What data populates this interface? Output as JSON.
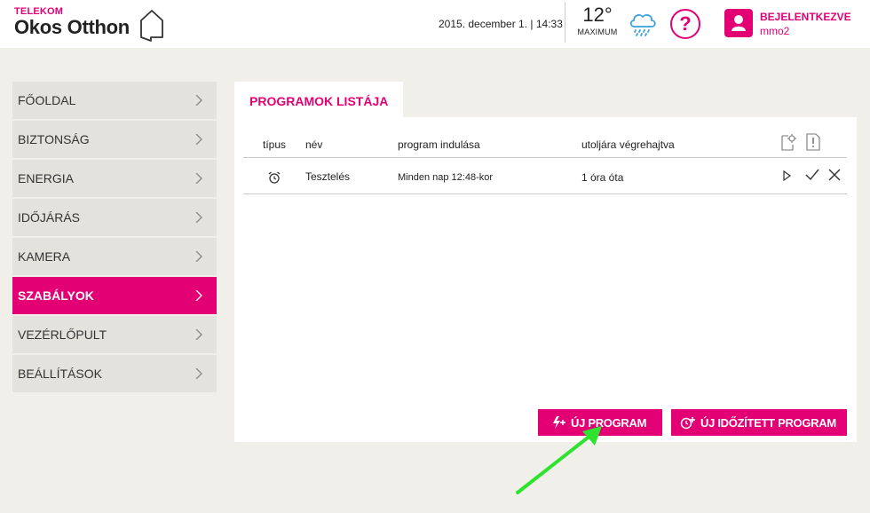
{
  "header": {
    "brand_small": "TELEKOM",
    "brand_big": "Okos Otthon",
    "datetime": "2015. december 1. | 14:33",
    "temperature": "12°",
    "temperature_label": "MAXIMUM",
    "weather_icon": "rain-cloud-icon",
    "help_label": "?",
    "login_status": "BEJELENTKEZVE",
    "username": "mmo2"
  },
  "sidebar": {
    "items": [
      {
        "label": "FŐOLDAL",
        "active": false
      },
      {
        "label": "BIZTONSÁG",
        "active": false
      },
      {
        "label": "ENERGIA",
        "active": false
      },
      {
        "label": "IDŐJÁRÁS",
        "active": false
      },
      {
        "label": "KAMERA",
        "active": false
      },
      {
        "label": "SZABÁLYOK",
        "active": true
      },
      {
        "label": "VEZÉRLŐPULT",
        "active": false
      },
      {
        "label": "BEÁLLÍTÁSOK",
        "active": false
      }
    ]
  },
  "main": {
    "title": "PROGRAMOK LISTÁJA",
    "columns": [
      "típus",
      "név",
      "program indulása",
      "utoljára végrehajtva"
    ],
    "rows": [
      {
        "type_icon": "alarm-clock-icon",
        "name": "Tesztelés",
        "start": "Minden nap 12:48-kor",
        "last_run": "1 óra óta"
      }
    ],
    "buttons": {
      "new_program": "ÚJ PROGRAM",
      "new_timed_program": "ÚJ IDŐZÍTETT PROGRAM"
    }
  },
  "colors": {
    "accent": "#e20074",
    "background": "#f1efea",
    "nav_bg": "#e4e2dd",
    "annotation_arrow": "#2ee32e"
  }
}
